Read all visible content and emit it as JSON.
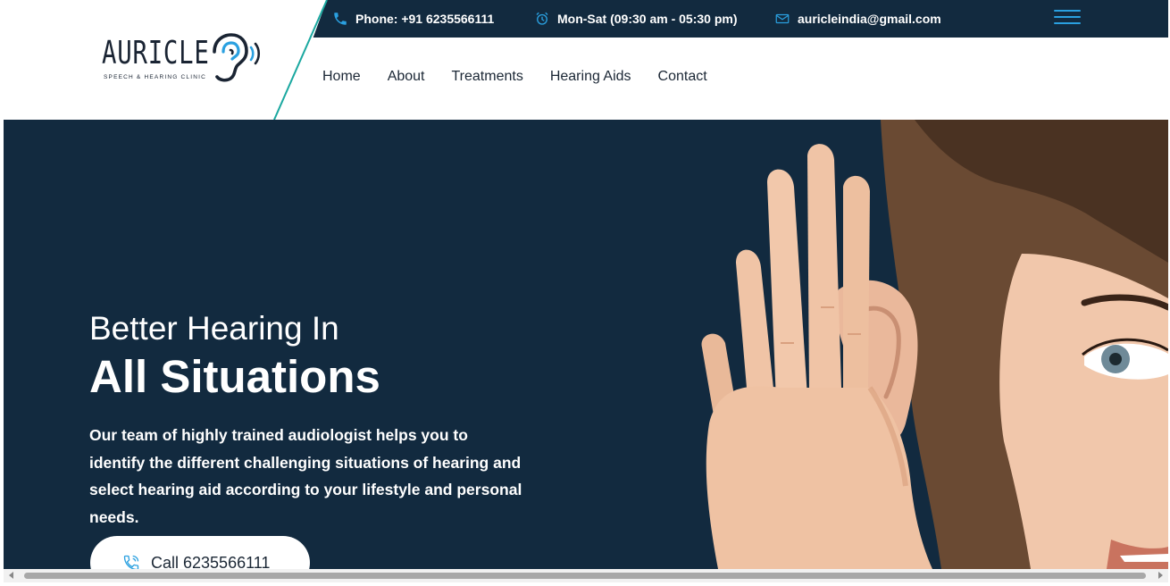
{
  "topbar": {
    "phone": "Phone: +91 6235566111",
    "hours": "Mon-Sat (09:30 am - 05:30 pm)",
    "email": "auricleindia@gmail.com",
    "icons": [
      "phone-icon",
      "alarm-clock-icon",
      "envelope-icon",
      "hamburger-menu-icon"
    ],
    "accent_color": "#2aa0e0",
    "background_color": "#122a3f"
  },
  "logo": {
    "wordmark": "AURICLE",
    "tagline": "SPEECH & HEARING CLINIC"
  },
  "nav": {
    "items": [
      {
        "label": "Home"
      },
      {
        "label": "About"
      },
      {
        "label": "Treatments"
      },
      {
        "label": "Hearing Aids"
      },
      {
        "label": "Contact"
      }
    ]
  },
  "hero": {
    "title_line1": "Better Hearing In",
    "title_line2": "All Situations",
    "description": "Our team of highly trained audiologist helps you to identify the different challenging situations of hearing and select hearing aid according to your lifestyle and personal needs.",
    "call_button": "Call 6235566111",
    "image_subject": "woman cupping hand behind ear",
    "background_color": "#122a3f"
  }
}
